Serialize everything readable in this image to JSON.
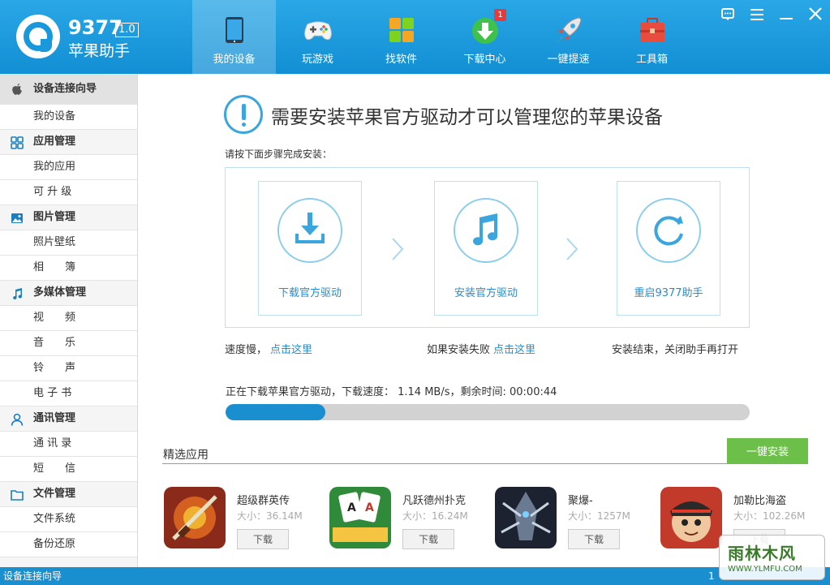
{
  "header": {
    "brand_number": "9377",
    "brand_version": "1.0",
    "brand_name": "苹果助手",
    "nav": [
      {
        "label": "我的设备",
        "icon": "tablet-icon"
      },
      {
        "label": "玩游戏",
        "icon": "gamepad-icon"
      },
      {
        "label": "找软件",
        "icon": "apps-grid-icon"
      },
      {
        "label": "下载中心",
        "icon": "download-circle-icon"
      },
      {
        "label": "一键提速",
        "icon": "rocket-icon"
      },
      {
        "label": "工具箱",
        "icon": "toolbox-icon"
      }
    ],
    "download_badge": "1"
  },
  "sidebar": {
    "groups": [
      {
        "label": "设备连接向导",
        "icon": "apple-icon",
        "items": [
          {
            "label": "我的设备"
          }
        ]
      },
      {
        "label": "应用管理",
        "icon": "grid-icon",
        "items": [
          {
            "label": "我的应用"
          },
          {
            "label": "可 升 级"
          }
        ]
      },
      {
        "label": "图片管理",
        "icon": "picture-icon",
        "items": [
          {
            "label": "照片壁纸"
          },
          {
            "label": "相　　簿"
          }
        ]
      },
      {
        "label": "多媒体管理",
        "icon": "music-note-icon",
        "items": [
          {
            "label": "视　　频"
          },
          {
            "label": "音　　乐"
          },
          {
            "label": "铃　　声"
          },
          {
            "label": "电 子 书"
          }
        ]
      },
      {
        "label": "通讯管理",
        "icon": "person-icon",
        "items": [
          {
            "label": "通 讯 录"
          },
          {
            "label": "短　　信"
          }
        ]
      },
      {
        "label": "文件管理",
        "icon": "folder-icon",
        "items": [
          {
            "label": "文件系统"
          },
          {
            "label": "备份还原"
          }
        ]
      }
    ]
  },
  "main": {
    "title": "需要安装苹果官方驱动才可以管理您的苹果设备",
    "steps_hint": "请按下面步骤完成安装：",
    "steps": [
      {
        "label": "下载官方驱动",
        "icon": "download-tray-icon"
      },
      {
        "label": "安装官方驱动",
        "icon": "music-note-icon"
      },
      {
        "label": "重启9377助手",
        "icon": "refresh-icon"
      }
    ],
    "notes": [
      {
        "text": "速度慢，",
        "link": "点击这里"
      },
      {
        "text": "如果安装失败",
        "link": "点击这里"
      },
      {
        "text": "安装结束，关闭助手再打开",
        "link": ""
      }
    ],
    "progress_text": "正在下载苹果官方驱动，下载速度： 1.14 MB/s，剩余时间: 00:00:44",
    "progress_fraction": 0.19
  },
  "featured": {
    "title": "精选应用",
    "install_all": "一键安装",
    "apps": [
      {
        "name": "超级群英传",
        "size": "大小：36.14M",
        "download": "下载",
        "color": "#8a2a1a"
      },
      {
        "name": "凡跃德州扑克",
        "size": "大小：16.24M",
        "download": "下载",
        "color": "#2f8a3a"
      },
      {
        "name": "聚爆-",
        "size": "大小：1257M",
        "download": "下载",
        "color": "#1c2230"
      },
      {
        "name": "加勒比海盗",
        "size": "大小：102.26M",
        "download": "下载",
        "color": "#c23a2a"
      }
    ]
  },
  "statusbar": {
    "left": "设备连接向导",
    "right": "1"
  },
  "watermark": {
    "title": "雨林木风",
    "sub": "WWW.YLMFU.COM"
  },
  "colors": {
    "header_blue": "#1a98dc",
    "link_blue": "#2a8ccf",
    "install_green": "#6cc04a",
    "progress_blue": "#1a8fd0"
  }
}
